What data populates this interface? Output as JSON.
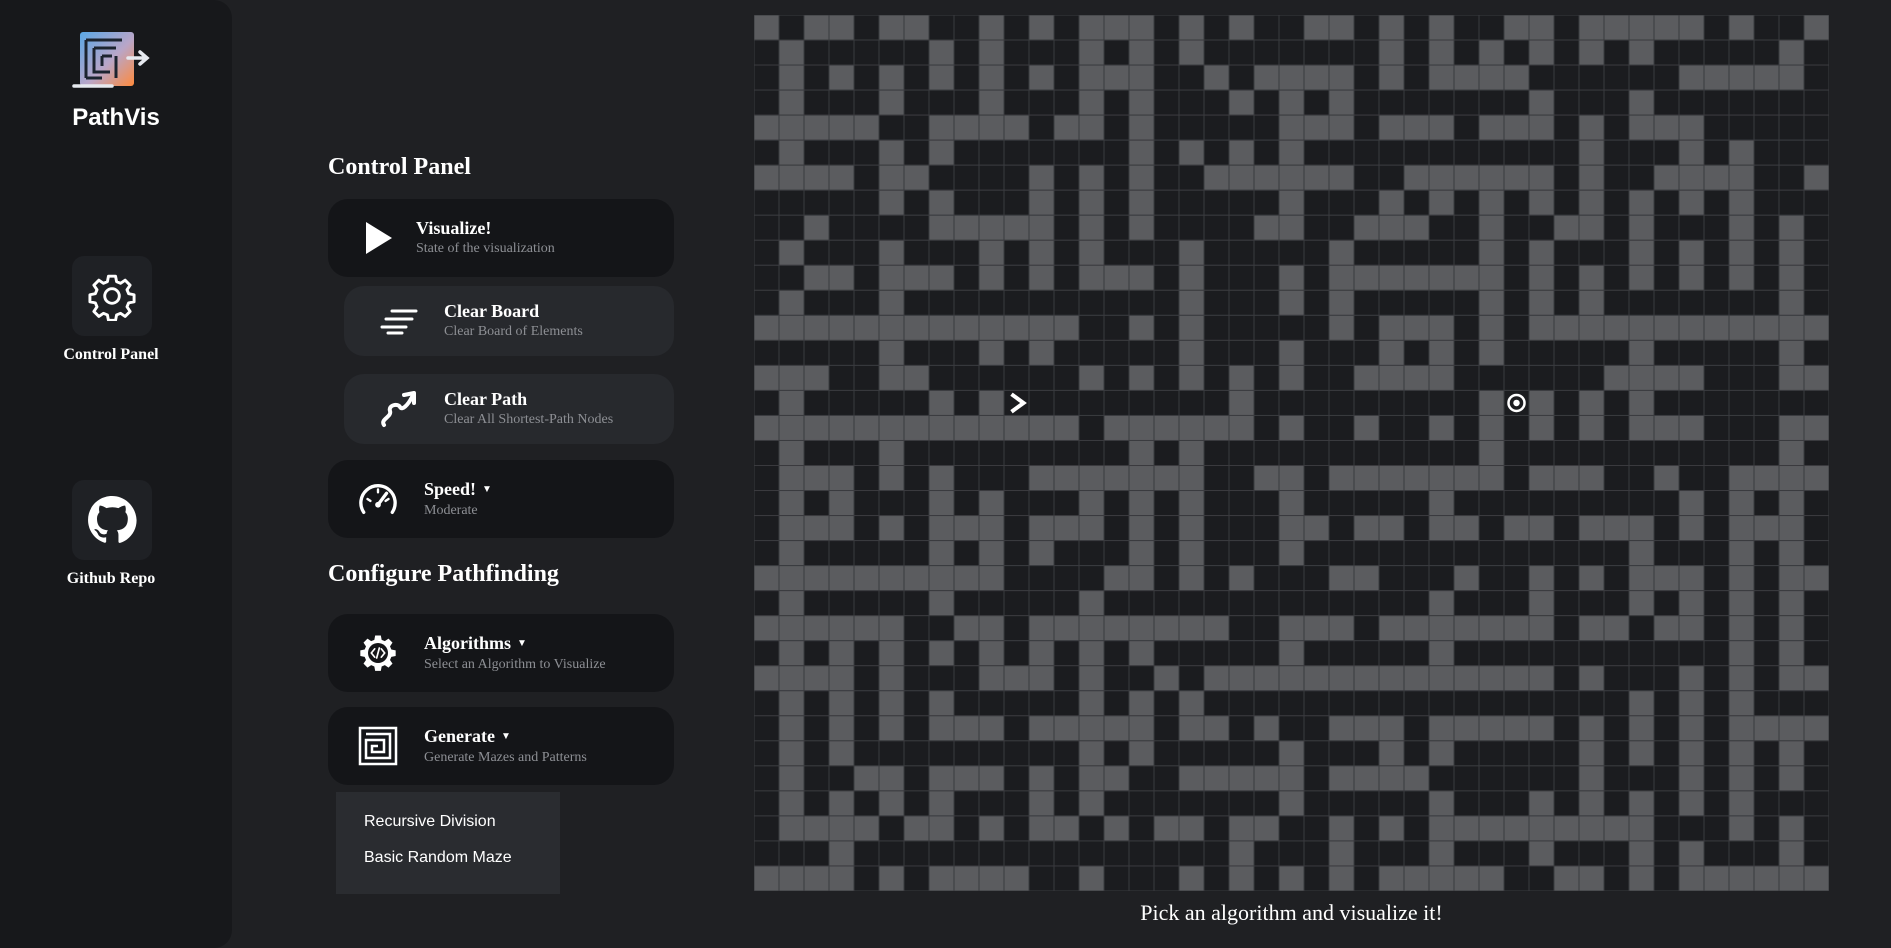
{
  "app": {
    "title": "PathVis"
  },
  "sidebar": {
    "items": [
      {
        "label": "Control Panel",
        "icon": "gear-icon"
      },
      {
        "label": "Github Repo",
        "icon": "github-icon"
      }
    ]
  },
  "control_panel": {
    "heading": "Control Panel",
    "visualize": {
      "title": "Visualize!",
      "subtitle": "State of the visualization"
    },
    "clear_board": {
      "title": "Clear Board",
      "subtitle": "Clear Board of Elements"
    },
    "clear_path": {
      "title": "Clear Path",
      "subtitle": "Clear All Shortest-Path Nodes"
    },
    "speed": {
      "title": "Speed!",
      "subtitle": "Moderate"
    }
  },
  "configure": {
    "heading": "Configure Pathfinding",
    "algorithms": {
      "title": "Algorithms",
      "subtitle": "Select an Algorithm to Visualize"
    },
    "generate": {
      "title": "Generate",
      "subtitle": "Generate Mazes and Patterns"
    },
    "generate_options": [
      "Recursive Division",
      "Basic Random Maze"
    ]
  },
  "grid": {
    "cols": 43,
    "rows": 35,
    "start_node": {
      "col": 10,
      "row": 15,
      "icon": "chevron-right-icon"
    },
    "target_node": {
      "col": 30,
      "row": 15,
      "icon": "target-icon"
    },
    "colors": {
      "wall": "#5b5c5f",
      "open": "#1b1c1f",
      "border": "#3a3b3f"
    }
  },
  "status": {
    "message": "Pick an algorithm and visualize it!"
  }
}
